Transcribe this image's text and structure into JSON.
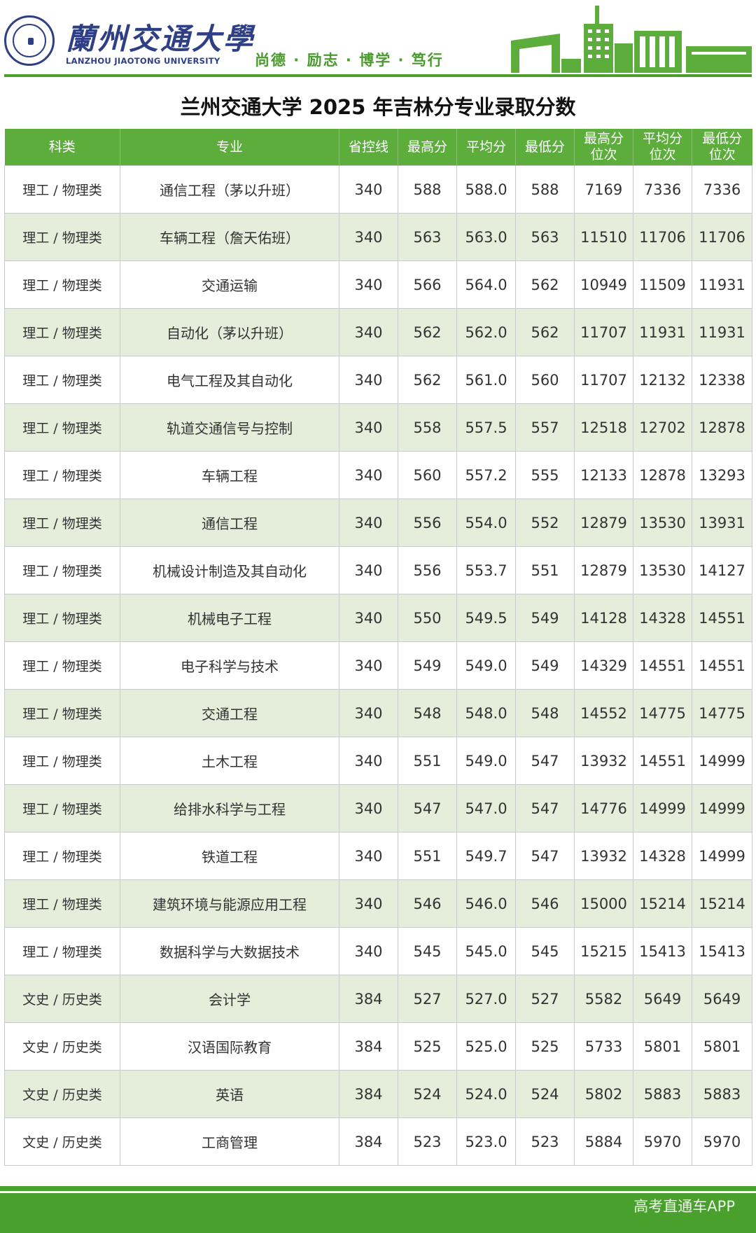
{
  "header": {
    "university_cn": "蘭州交通大學",
    "university_en": "LANZHOU JIAOTONG UNIVERSITY",
    "motto": "尚德 · 励志 · 博学 · 笃行",
    "logo_icon": "university-seal-icon",
    "skyline_icon": "campus-skyline-icon",
    "brand_color": "#4aa02c"
  },
  "title": "兰州交通大学 2025 年吉林分专业录取分数",
  "table": {
    "headers": [
      "科类",
      "专业",
      "省控线",
      "最高分",
      "平均分",
      "最低分",
      "最高分位次",
      "平均分位次",
      "最低分位次"
    ],
    "header_lines": [
      [
        "科类"
      ],
      [
        "专业"
      ],
      [
        "省控线"
      ],
      [
        "最高分"
      ],
      [
        "平均分"
      ],
      [
        "最低分"
      ],
      [
        "最高分",
        "位次"
      ],
      [
        "平均分",
        "位次"
      ],
      [
        "最低分",
        "位次"
      ]
    ],
    "rows": [
      [
        "理工 / 物理类",
        "通信工程（茅以升班）",
        "340",
        "588",
        "588.0",
        "588",
        "7169",
        "7336",
        "7336"
      ],
      [
        "理工 / 物理类",
        "车辆工程（詹天佑班）",
        "340",
        "563",
        "563.0",
        "563",
        "11510",
        "11706",
        "11706"
      ],
      [
        "理工 / 物理类",
        "交通运输",
        "340",
        "566",
        "564.0",
        "562",
        "10949",
        "11509",
        "11931"
      ],
      [
        "理工 / 物理类",
        "自动化（茅以升班）",
        "340",
        "562",
        "562.0",
        "562",
        "11707",
        "11931",
        "11931"
      ],
      [
        "理工 / 物理类",
        "电气工程及其自动化",
        "340",
        "562",
        "561.0",
        "560",
        "11707",
        "12132",
        "12338"
      ],
      [
        "理工 / 物理类",
        "轨道交通信号与控制",
        "340",
        "558",
        "557.5",
        "557",
        "12518",
        "12702",
        "12878"
      ],
      [
        "理工 / 物理类",
        "车辆工程",
        "340",
        "560",
        "557.2",
        "555",
        "12133",
        "12878",
        "13293"
      ],
      [
        "理工 / 物理类",
        "通信工程",
        "340",
        "556",
        "554.0",
        "552",
        "12879",
        "13530",
        "13931"
      ],
      [
        "理工 / 物理类",
        "机械设计制造及其自动化",
        "340",
        "556",
        "553.7",
        "551",
        "12879",
        "13530",
        "14127"
      ],
      [
        "理工 / 物理类",
        "机械电子工程",
        "340",
        "550",
        "549.5",
        "549",
        "14128",
        "14328",
        "14551"
      ],
      [
        "理工 / 物理类",
        "电子科学与技术",
        "340",
        "549",
        "549.0",
        "549",
        "14329",
        "14551",
        "14551"
      ],
      [
        "理工 / 物理类",
        "交通工程",
        "340",
        "548",
        "548.0",
        "548",
        "14552",
        "14775",
        "14775"
      ],
      [
        "理工 / 物理类",
        "土木工程",
        "340",
        "551",
        "549.0",
        "547",
        "13932",
        "14551",
        "14999"
      ],
      [
        "理工 / 物理类",
        "给排水科学与工程",
        "340",
        "547",
        "547.0",
        "547",
        "14776",
        "14999",
        "14999"
      ],
      [
        "理工 / 物理类",
        "铁道工程",
        "340",
        "551",
        "549.7",
        "547",
        "13932",
        "14328",
        "14999"
      ],
      [
        "理工 / 物理类",
        "建筑环境与能源应用工程",
        "340",
        "546",
        "546.0",
        "546",
        "15000",
        "15214",
        "15214"
      ],
      [
        "理工 / 物理类",
        "数据科学与大数据技术",
        "340",
        "545",
        "545.0",
        "545",
        "15215",
        "15413",
        "15413"
      ],
      [
        "文史 / 历史类",
        "会计学",
        "384",
        "527",
        "527.0",
        "527",
        "5582",
        "5649",
        "5649"
      ],
      [
        "文史 / 历史类",
        "汉语国际教育",
        "384",
        "525",
        "525.0",
        "525",
        "5733",
        "5801",
        "5801"
      ],
      [
        "文史 / 历史类",
        "英语",
        "384",
        "524",
        "524.0",
        "524",
        "5802",
        "5883",
        "5883"
      ],
      [
        "文史 / 历史类",
        "工商管理",
        "384",
        "523",
        "523.0",
        "523",
        "5884",
        "5970",
        "5970"
      ]
    ]
  },
  "footer": {
    "watermark": "高考直通车APP"
  }
}
